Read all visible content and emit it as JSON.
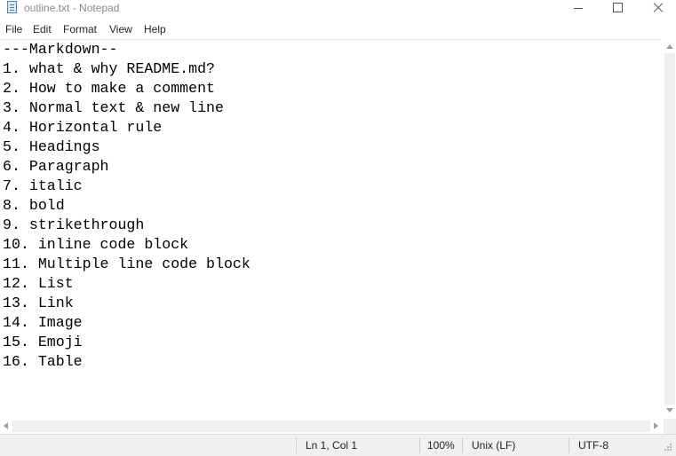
{
  "window": {
    "title": "outline.txt - Notepad"
  },
  "menu": {
    "items": [
      "File",
      "Edit",
      "Format",
      "View",
      "Help"
    ]
  },
  "editor": {
    "lines": [
      "---Markdown--",
      "1. what & why README.md?",
      "2. How to make a comment",
      "3. Normal text & new line",
      "4. Horizontal rule",
      "5. Headings",
      "6. Paragraph",
      "7. italic",
      "8. bold",
      "9. strikethrough",
      "10. inline code block",
      "11. Multiple line code block",
      "12. List",
      "13. Link",
      "14. Image",
      "15. Emoji",
      "16. Table"
    ]
  },
  "status": {
    "position": "Ln 1, Col 1",
    "zoom": "100%",
    "line_ending": "Unix (LF)",
    "encoding": "UTF-8"
  },
  "icons": {
    "app": "notepad-icon",
    "minimize": "minimize-icon",
    "maximize": "maximize-icon",
    "close": "close-icon"
  }
}
